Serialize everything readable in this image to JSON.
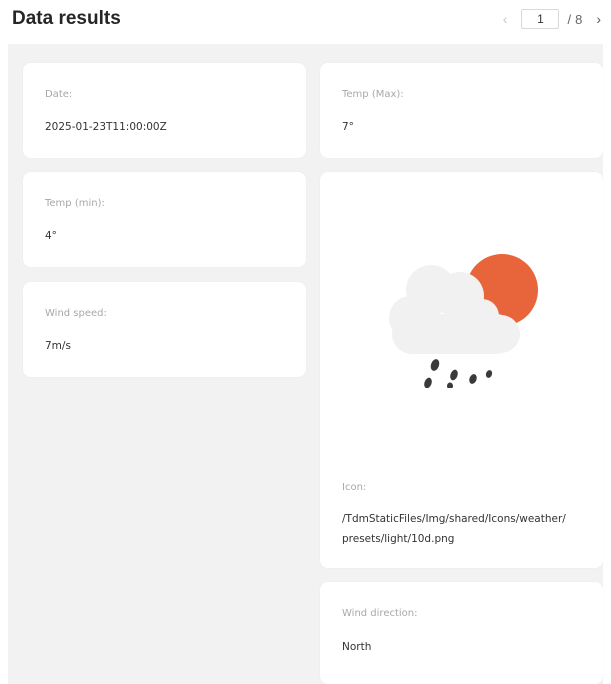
{
  "header": {
    "title": "Data results",
    "pager": {
      "prev_icon": "chevron-left-icon",
      "next_icon": "chevron-right-icon",
      "current_page": "1",
      "separator": "/",
      "total_pages": "8"
    }
  },
  "cards": {
    "date": {
      "label": "Date:",
      "value": "2025-01-23T11:00:00Z"
    },
    "temp_max": {
      "label": "Temp (Max):",
      "value": "7°"
    },
    "temp_min": {
      "label": "Temp (min):",
      "value": "4°"
    },
    "wind_speed": {
      "label": "Wind speed:",
      "value": "7m/s"
    },
    "icon": {
      "label": "Icon:",
      "value_line1": "/TdmStaticFiles/Img/shared/Icons/weather/",
      "value_line2": "presets/light/10d.png",
      "icon_name": "cloud-sun-rain-icon"
    },
    "wind_direction": {
      "label": "Wind direction:",
      "value": "North"
    }
  },
  "colors": {
    "sun": "#e8653c",
    "cloud": "#f1f1f1",
    "rain": "#3a3a3a",
    "panel_bg": "#f2f2f2"
  }
}
